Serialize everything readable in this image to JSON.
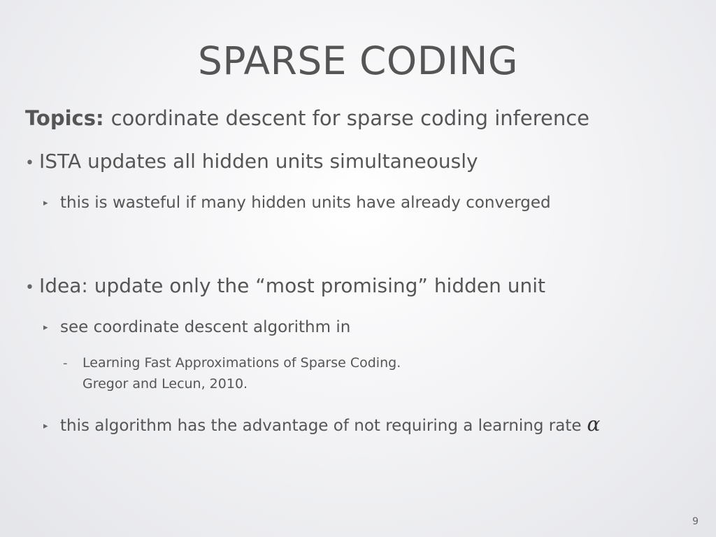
{
  "slide": {
    "title": "SPARSE CODING",
    "topics_label": "Topics:",
    "topics_text": "coordinate descent for sparse coding inference",
    "bullets": [
      {
        "marker": "•",
        "text": "ISTA updates all hidden units simultaneously"
      },
      {
        "marker": "▸",
        "text": "this is wasteful if many hidden units have already converged"
      },
      {
        "marker": "•",
        "text": "Idea: update only the “most promising” hidden unit"
      },
      {
        "marker": "▸",
        "text": "see coordinate descent algorithm in"
      },
      {
        "marker": "-",
        "text": "Learning Fast Approximations of Sparse Coding.",
        "continuation": "Gregor and Lecun, 2010."
      },
      {
        "marker": "▸",
        "text": "this algorithm has the advantage of not requiring a learning rate",
        "symbol": "α"
      }
    ],
    "page_number": "9"
  }
}
